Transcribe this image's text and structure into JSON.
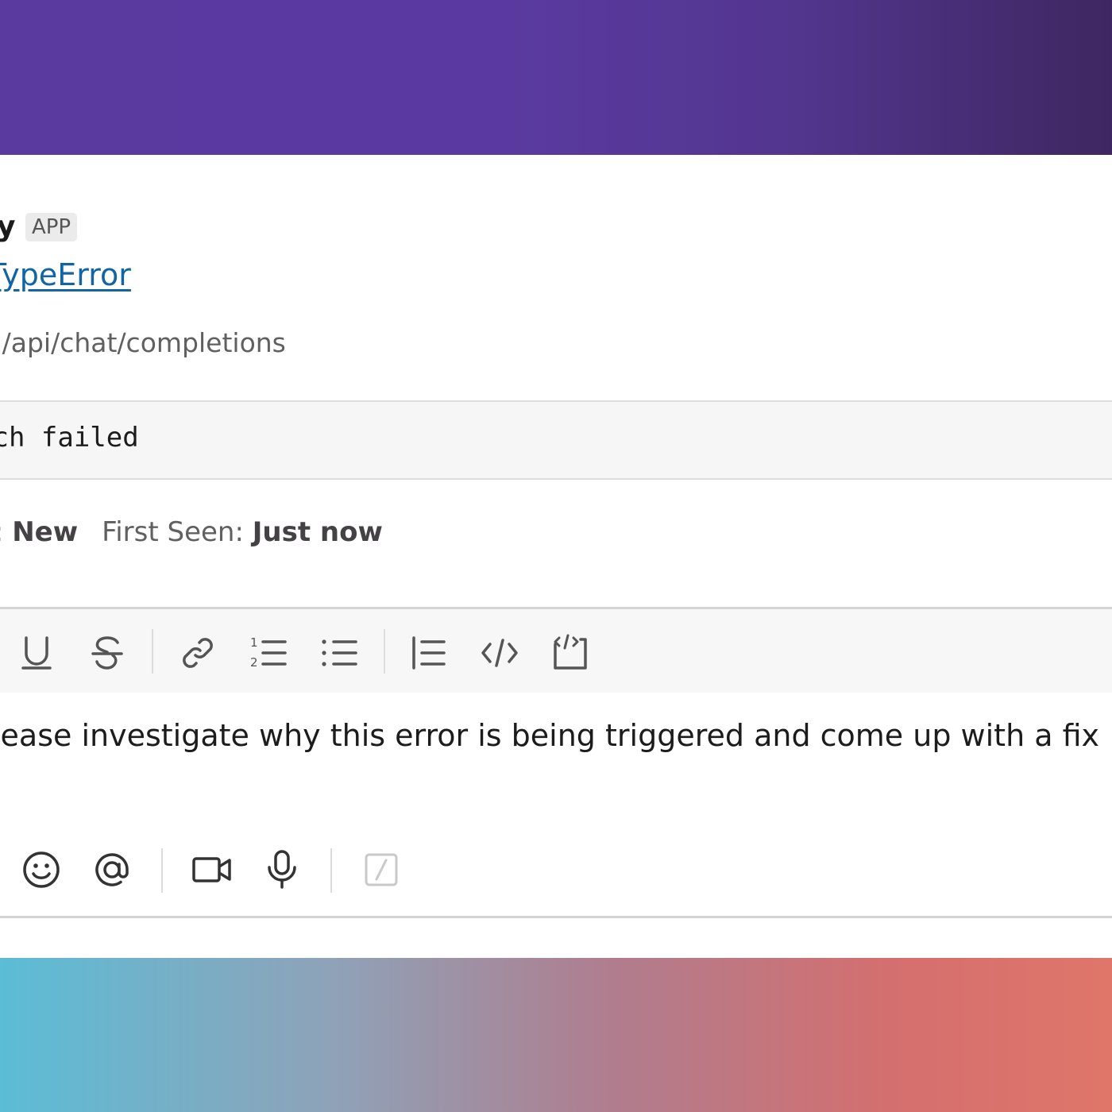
{
  "message": {
    "sender": "try",
    "sender_badge": "APP",
    "issue_title": "TypeError",
    "issue_subtitle": "T /api/chat/completions",
    "code": "tch failed",
    "fields": [
      {
        "label": "e:",
        "value": "New"
      },
      {
        "label": "First Seen:",
        "value": "Just now"
      }
    ]
  },
  "composer": {
    "text": "lease investigate why this error is being triggered and come up with a fix",
    "toolbar_icons": [
      "underline-icon",
      "strikethrough-icon",
      "link-icon",
      "ordered-list-icon",
      "bulleted-list-icon",
      "blockquote-icon",
      "code-icon",
      "code-block-icon"
    ],
    "bottom_icons": [
      "emoji-icon",
      "mention-icon",
      "video-icon",
      "microphone-icon",
      "slash-command-icon"
    ]
  },
  "colors": {
    "link": "#1264a3",
    "top_gradient_start": "#5a3a9f",
    "bottom_gradient_start": "#5bbdd6",
    "bottom_gradient_end": "#e0766a"
  }
}
